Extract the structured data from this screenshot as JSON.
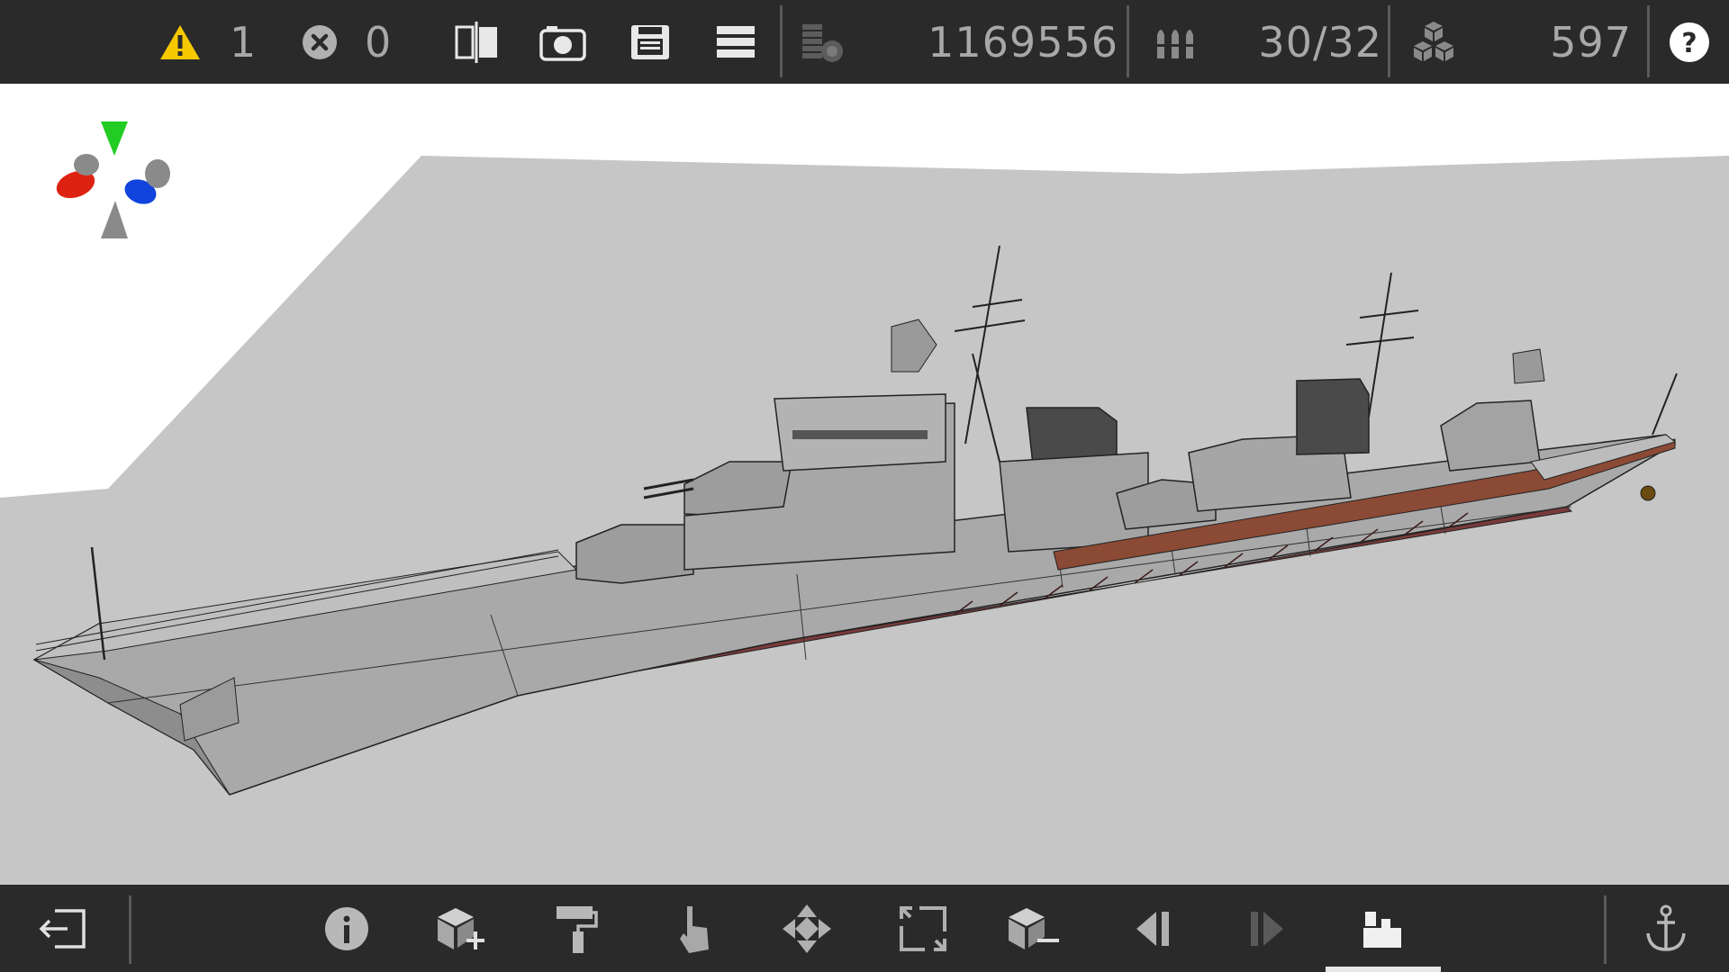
{
  "topbar": {
    "warnings": {
      "icon": "warning-triangle-icon",
      "count": "1"
    },
    "errors": {
      "icon": "error-circle-icon",
      "count": "0"
    },
    "buttons": [
      {
        "name": "split-view-icon"
      },
      {
        "name": "camera-icon"
      },
      {
        "name": "save-icon"
      },
      {
        "name": "menu-icon"
      }
    ],
    "cost": {
      "icon": "coins-icon",
      "value": "1169556"
    },
    "armament": {
      "icon": "ammo-icon",
      "value": "30/32"
    },
    "parts": {
      "icon": "parts-cubes-icon",
      "value": "597"
    },
    "help": {
      "icon": "help-icon",
      "label": "?"
    }
  },
  "bottombar": {
    "tools": [
      {
        "name": "exit-icon",
        "active": false
      },
      {
        "name": "info-icon",
        "active": false
      },
      {
        "name": "add-part-icon",
        "active": false
      },
      {
        "name": "paint-roller-icon",
        "active": false
      },
      {
        "name": "select-hand-icon",
        "active": false
      },
      {
        "name": "move-arrows-icon",
        "active": false
      },
      {
        "name": "resize-icon",
        "active": false
      },
      {
        "name": "remove-part-icon",
        "active": false
      },
      {
        "name": "undo-icon",
        "active": false
      },
      {
        "name": "redo-icon",
        "active": false
      },
      {
        "name": "build-mode-icon",
        "active": true
      },
      {
        "name": "anchor-icon",
        "active": false
      }
    ]
  },
  "colors": {
    "bar_bg": "#2a2a2a",
    "warning": "#f5c800",
    "gizmo_y": "#22cc22",
    "gizmo_x": "#dd2211",
    "gizmo_z": "#1144dd",
    "hull_gray": "#a9a9a9",
    "hull_waterline": "#7a3a3a",
    "deck_wood": "#8b4a35"
  }
}
